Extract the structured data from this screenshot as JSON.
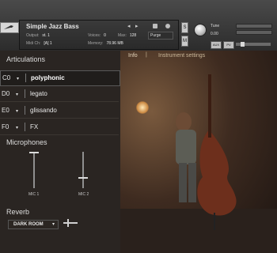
{
  "header": {
    "instrument_title": "Simple Jazz Bass",
    "output_label": "Output:",
    "output_value": "st. 1",
    "midi_label": "Midi Ch:",
    "midi_value": "[A] 1",
    "voices_label": "Voices:",
    "voices_value": "0",
    "max_label": "Max:",
    "max_value": "128",
    "memory_label": "Memory:",
    "memory_value": "78.96 MB",
    "purge_label": "Purge",
    "tune_label": "Tune",
    "tune_value": "0.00",
    "s_label": "S",
    "m_label": "M",
    "aux_label": "AUX",
    "pv_label": "PV"
  },
  "tabs": {
    "info": "Info",
    "settings": "Instrument settings"
  },
  "articulations": {
    "title": "Articulations",
    "items": [
      {
        "key": "C0",
        "name": "polyphonic",
        "selected": true
      },
      {
        "key": "D0",
        "name": "legato",
        "selected": false
      },
      {
        "key": "E0",
        "name": "glissando",
        "selected": false
      },
      {
        "key": "F0",
        "name": "FX",
        "selected": false
      }
    ]
  },
  "microphones": {
    "title": "Microphones",
    "mic1": {
      "label": "MIC 1",
      "level": 1.0
    },
    "mic2": {
      "label": "MIC 2",
      "level": 0.3
    }
  },
  "reverb": {
    "title": "Reverb",
    "preset": "DARK ROOM",
    "level": 0.3
  },
  "colors": {
    "panel_bg": "#2a2522",
    "header_bg": "#3a3a3a",
    "text_primary": "#e9e9e9"
  }
}
